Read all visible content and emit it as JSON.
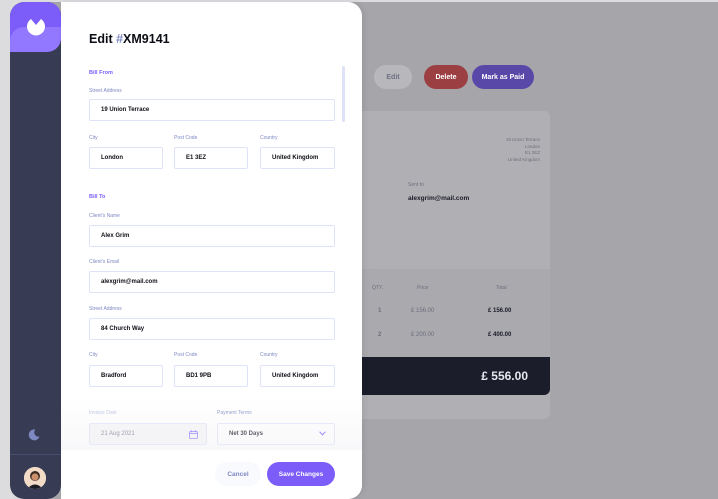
{
  "colors": {
    "accent": "#7c5dfa",
    "sidebar": "#373b53",
    "danger": "#ec5757",
    "label": "#7e88c3"
  },
  "background_page": {
    "edit_label": "Edit",
    "delete_label": "Delete",
    "mark_paid_label": "Mark as Paid",
    "sender_address": [
      "19 Union Terrace",
      "London",
      "E1 3EZ",
      "United Kingdom"
    ],
    "sent_to_label": "Sent to",
    "sent_to_value": "alexgrim@mail.com",
    "items_header": {
      "qty": "QTY.",
      "price": "Price",
      "total": "Total"
    },
    "items": [
      {
        "qty": "1",
        "price": "£ 156.00",
        "total": "£ 156.00"
      },
      {
        "qty": "2",
        "price": "£ 200.00",
        "total": "£ 400.00"
      }
    ],
    "grand_total": "£ 556.00"
  },
  "drawer": {
    "title_prefix": "Edit ",
    "title_hash": "#",
    "title_id": "XM9141",
    "bill_from": {
      "heading": "Bill From",
      "street_label": "Street Address",
      "street": "19 Union Terrace",
      "city_label": "City",
      "city": "London",
      "post_label": "Post Code",
      "post": "E1 3EZ",
      "country_label": "Country",
      "country": "United Kingdom"
    },
    "bill_to": {
      "heading": "Bill To",
      "name_label": "Client's Name",
      "name": "Alex Grim",
      "email_label": "Client's Email",
      "email": "alexgrim@mail.com",
      "street_label": "Street Address",
      "street": "84 Church Way",
      "city_label": "City",
      "city": "Bradford",
      "post_label": "Post Code",
      "post": "BD1 9PB",
      "country_label": "Country",
      "country": "United Kingdom"
    },
    "invoice_date_label": "Invoice Date",
    "invoice_date": "21 Aug 2021",
    "payment_terms_label": "Payment Terms",
    "payment_terms": "Net 30 Days",
    "cancel_label": "Cancel",
    "save_label": "Save Changes"
  },
  "icons": {
    "logo": "logo-icon",
    "theme": "moon-icon",
    "date": "calendar-icon",
    "dropdown": "chevron-down-icon"
  }
}
